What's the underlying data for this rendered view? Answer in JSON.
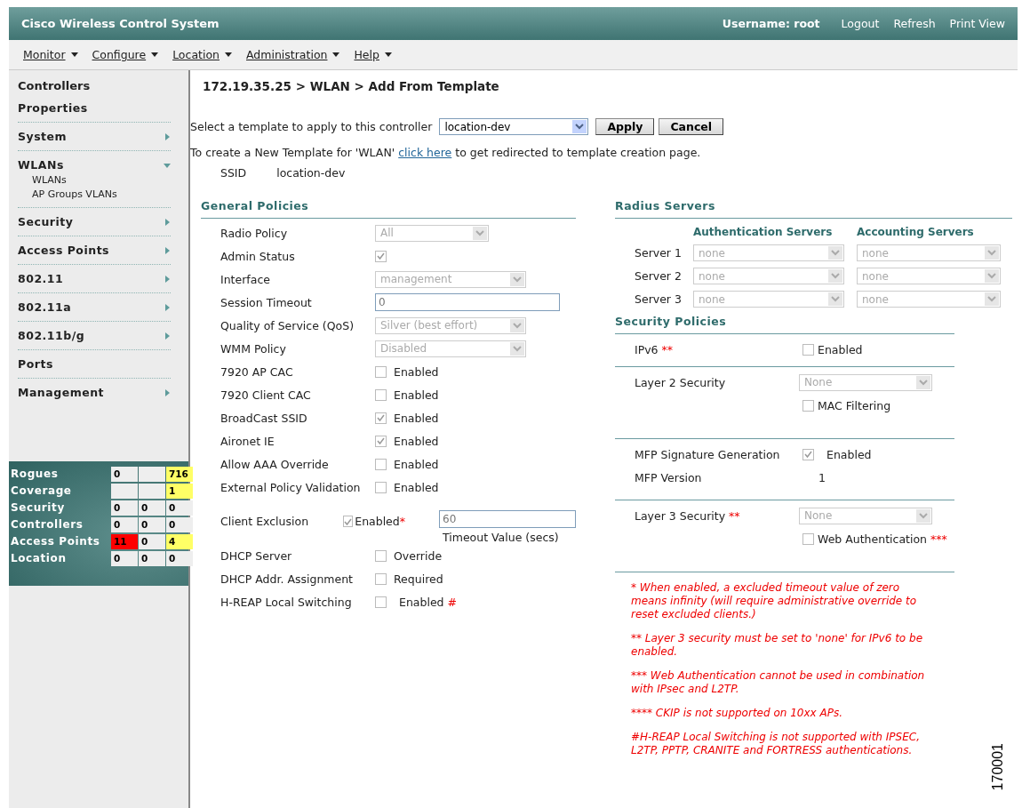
{
  "header": {
    "title": "Cisco Wireless Control System",
    "username": "Username: root",
    "links": [
      "Logout",
      "Refresh",
      "Print View"
    ]
  },
  "menu": [
    {
      "label": "Monitor"
    },
    {
      "label": "Configure"
    },
    {
      "label": "Location"
    },
    {
      "label": "Administration"
    },
    {
      "label": "Help"
    }
  ],
  "sidebar": {
    "title": "Controllers",
    "items": [
      {
        "label": "Properties",
        "kind": "plain"
      },
      {
        "label": "System",
        "kind": "menu",
        "expanded": false
      },
      {
        "label": "WLANs",
        "kind": "menu",
        "expanded": true,
        "children": [
          {
            "label": "WLANs"
          },
          {
            "label": "AP Groups VLANs"
          }
        ]
      },
      {
        "label": "Security",
        "kind": "menu",
        "expanded": false
      },
      {
        "label": "Access Points",
        "kind": "menu",
        "expanded": false
      },
      {
        "label": "802.11",
        "kind": "menu",
        "expanded": false
      },
      {
        "label": "802.11a",
        "kind": "menu",
        "expanded": false
      },
      {
        "label": "802.11b/g",
        "kind": "menu",
        "expanded": false
      },
      {
        "label": "Ports",
        "kind": "plain"
      },
      {
        "label": "Management",
        "kind": "menu",
        "expanded": false
      }
    ]
  },
  "alarm_summary": [
    {
      "label": "Rogues",
      "cells": [
        {
          "value": "0",
          "color": "#eeeeee"
        },
        {
          "color": "#eeeeee"
        },
        {
          "value": "716",
          "color": "#ffff66"
        }
      ]
    },
    {
      "label": "Coverage",
      "cells": [
        {
          "color": "#eeeeee"
        },
        {
          "color": "#eeeeee"
        },
        {
          "value": "1",
          "color": "#ffff66"
        }
      ]
    },
    {
      "label": "Security",
      "cells": [
        {
          "value": "0",
          "color": "#eeeeee"
        },
        {
          "value": "0",
          "color": "#eeeeee"
        },
        {
          "value": "0",
          "color": "#eeeeee"
        }
      ]
    },
    {
      "label": "Controllers",
      "cells": [
        {
          "value": "0",
          "color": "#eeeeee"
        },
        {
          "value": "0",
          "color": "#eeeeee"
        },
        {
          "value": "0",
          "color": "#eeeeee"
        }
      ]
    },
    {
      "label": "Access Points",
      "cells": [
        {
          "value": "11",
          "color": "#ff0000"
        },
        {
          "value": "0",
          "color": "#eeeeee"
        },
        {
          "value": "4",
          "color": "#ffff66"
        }
      ]
    },
    {
      "label": "Location",
      "cells": [
        {
          "value": "0",
          "color": "#eeeeee"
        },
        {
          "value": "0",
          "color": "#eeeeee"
        },
        {
          "value": "0",
          "color": "#eeeeee"
        }
      ]
    }
  ],
  "breadcrumb": "172.19.35.25 > WLAN > Add From Template",
  "template_select": {
    "label": "Select a template to apply to this controller",
    "value": "location-dev",
    "buttons": [
      "Apply",
      "Cancel"
    ]
  },
  "template_note": {
    "before": "To create a New Template for 'WLAN'",
    "link": "click here",
    "after": "to get redirected to template creation page."
  },
  "ssid": {
    "label": "SSID",
    "value": "location-dev"
  },
  "general_policies": {
    "title": "General Policies",
    "rows": [
      {
        "label": "Radio Policy",
        "kind": "select",
        "value": "All"
      },
      {
        "label": "Admin Status",
        "kind": "checkbox",
        "checked": true
      },
      {
        "label": "Interface",
        "kind": "select",
        "value": "management"
      },
      {
        "label": "Session Timeout",
        "kind": "text",
        "value": "0"
      },
      {
        "label": "Quality of Service (QoS)",
        "kind": "select",
        "value": "Silver (best effort)"
      },
      {
        "label": "WMM Policy",
        "kind": "select",
        "value": "Disabled"
      },
      {
        "label": "7920 AP CAC",
        "kind": "checkbox",
        "checked": false,
        "option": "Enabled"
      },
      {
        "label": "7920 Client CAC",
        "kind": "checkbox",
        "checked": false,
        "option": "Enabled"
      },
      {
        "label": "BroadCast SSID",
        "kind": "checkbox",
        "checked": true,
        "option": "Enabled"
      },
      {
        "label": "Aironet IE",
        "kind": "checkbox",
        "checked": true,
        "option": "Enabled"
      },
      {
        "label": "Allow AAA Override",
        "kind": "checkbox",
        "checked": false,
        "option": "Enabled"
      },
      {
        "label": "External Policy Validation",
        "kind": "checkbox",
        "checked": false,
        "option": "Enabled"
      },
      {
        "label": "Client Exclusion",
        "kind": "checkbox",
        "checked": true,
        "option": "Enabled",
        "marker": "*",
        "timeout": {
          "value": "60",
          "caption": "Timeout Value (secs)"
        }
      },
      {
        "label": "DHCP Server",
        "kind": "checkbox",
        "checked": false,
        "option": "Override"
      },
      {
        "label": "DHCP Addr. Assignment",
        "kind": "checkbox",
        "checked": false,
        "option": "Required"
      },
      {
        "label": "H-REAP Local Switching",
        "kind": "checkbox",
        "checked": false,
        "option": "Enabled",
        "marker": "#"
      }
    ]
  },
  "radius_servers": {
    "title": "Radius Servers",
    "columns": [
      "Authentication Servers",
      "Accounting Servers"
    ],
    "rows": [
      {
        "label": "Server 1",
        "auth": "none",
        "acct": "none"
      },
      {
        "label": "Server 2",
        "auth": "none",
        "acct": "none"
      },
      {
        "label": "Server 3",
        "auth": "none",
        "acct": "none"
      }
    ]
  },
  "security_policies": {
    "title": "Security Policies",
    "groups": [
      [
        {
          "label": "IPv6",
          "marker": "**",
          "kind": "checkbox",
          "checked": false,
          "option": "Enabled"
        }
      ],
      [
        {
          "label": "Layer 2 Security",
          "kind": "select",
          "value": "None"
        },
        {
          "kind": "checkbox",
          "checked": false,
          "option": "MAC Filtering"
        }
      ],
      [
        {
          "label": "MFP Signature Generation",
          "kind": "checkbox",
          "checked": true,
          "option": "Enabled"
        },
        {
          "label": "MFP Version",
          "kind": "text",
          "value": "1"
        }
      ],
      [
        {
          "label": "Layer 3 Security",
          "marker": "**",
          "kind": "select",
          "value": "None"
        },
        {
          "kind": "checkbox",
          "checked": false,
          "option": "Web Authentication",
          "marker": "***"
        }
      ]
    ]
  },
  "notes": [
    "* When enabled, a excluded timeout value of zero means infinity (will require administrative override to reset excluded clients.)",
    "** Layer 3 security must be set to 'none' for IPv6 to be enabled.",
    "*** Web Authentication cannot be used in combination with IPsec and L2TP.",
    "**** CKIP is not supported on 10xx APs.",
    "#H-REAP Local Switching is not supported with IPSEC, L2TP, PPTP, CRANITE and FORTRESS authentications."
  ],
  "figure_number": "170001"
}
